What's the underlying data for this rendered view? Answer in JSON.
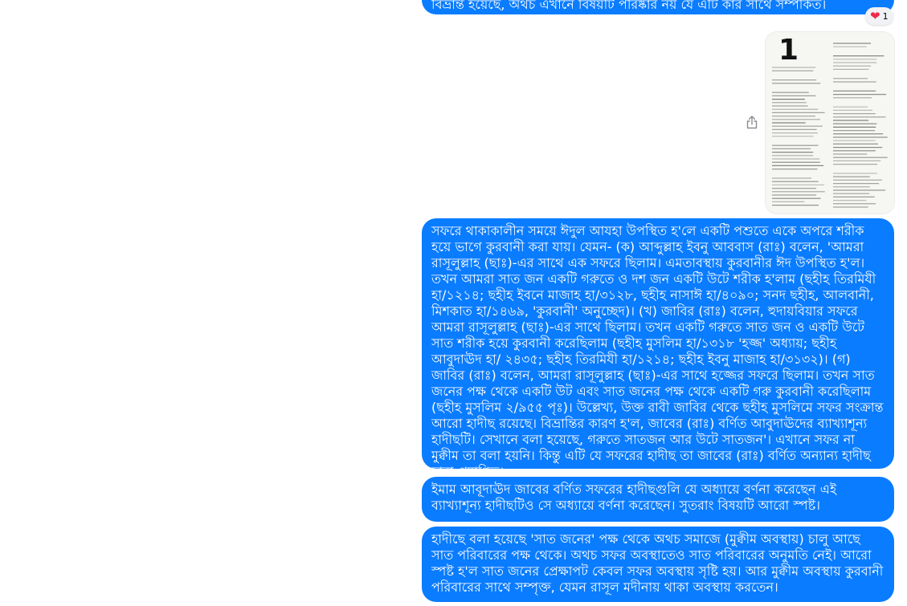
{
  "messages": {
    "top_partial": {
      "text": "বিভ্রান্ত হয়েছে, অথচ এখানে বিষয়টি পরিষ্কার নয় যে এটি কার সাথে সম্পর্কিত।",
      "reaction_emoji": "❤",
      "reaction_count": "1"
    },
    "image_message": {
      "page_number": "1"
    },
    "msg1": "সফরে থাকাকালীন সময়ে ঈদুল আযহা উপস্থিত হ'লে একটি পশুতে একে অপরে শরীক হয়ে ভাগে কুরবানী করা যায়। যেমন- (ক) আব্দুল্লাহ ইবনু আববাস (রাঃ) বলেন, 'আমরা রাসূলুল্লাহ (ছাঃ)-এর সাথে এক সফরে ছিলাম। এমতাবস্থায় কুরবানীর ঈদ উপস্থিত হ'ল। তখন আমরা সাত জন একটি গরুতে ও দশ জন একটি উটে শরীক হ'লাম (ছহীহ তিরমিযী হা/১২১৪; ছহীহ ইবনে মাজাহ হা/৩১২৮, ছহীহ নাসাঈ হা/৪০৯০; সনদ ছহীহ, আলবানী, মিশকাত হা/১৪৬৯, 'কুরবানী' অনুচ্ছেদ)। (খ) জাবির (রাঃ) বলেন, হুদায়বিয়ার সফরে আমরা রাসূলুল্লাহ (ছাঃ)-এর সাথে ছিলাম। তখন একটি গরুতে সাত জন ও একটি উটে সাত শরীক হয়ে কুরবানী করেছিলাম (ছহীহ মুসলিম হা/১৩১৮ 'হজ্জ' অধ্যায়; ছহীহ আবুদাঊদ হা/ ২৪৩৫; ছহীহ তিরমিযী হা/১২১৪; ছহীহ ইবনু মাজাহ হা/৩১৩২)। (গ) জাবির (রাঃ) বলেন, আমরা রাসূলুল্লাহ (ছাঃ)-এর সাথে হজ্জের সফরে ছিলাম। তখন সাত জনের পক্ষ থেকে একটি উট এবং সাত জনের পক্ষ থেকে একটি গরু কুরবানী করেছিলাম (ছহীহ মুসলিম ২/৯৫৫ পৃঃ)। উল্লেখ্য, উক্ত রাবী জাবির থেকে ছহীহ মুসলিমে সফর সংক্রান্ত আরো হাদীছ রয়েছে। বিভ্রান্তির কারণ হ'ল, জাবের (রাঃ) বর্ণিত আবুদাঊদের ব্যাখ্যাশূন্য হাদীছটি। সেখানে বলা হয়েছে, গরুতে সাতজন আর উটে সাতজন'। এখানে সফর না মুক্বীম তা বলা হয়নি। কিন্তু এটি যে সফরের হাদীছ তা জাবের (রাঃ) বর্ণিত অন্যান্য হাদীছ দ্বারা প্রমাণিত।",
    "msg2": "ইমাম আবূদাঊদ জাবের বর্ণিত সফরের হাদীছগুলি যে অধ্যায়ে  বর্ণনা করেছেন এই ব্যাখ্যাশূন্য হাদীছটিও সে অধ্যায়ে বর্ণনা করেছেন। সুতরাং বিষয়টি আরো স্পষ্ট।",
    "msg3": "হাদীছে বলা হয়েছে 'সাত জনের' পক্ষ থেকে অথচ সমাজে (মুক্বীম অবস্থায়) চালু আছে সাত পরিবারের পক্ষ থেকে। অথচ সফর অবস্থাতেও সাত পরিবারের অনুমতি নেই। আরো স্পষ্ট হ'ল সাত জনের প্রেক্ষাপট কেবল সফর অবস্থায় সৃষ্টি হয়। আর মুক্বীম অবস্থায় কুরবানী পরিবারের সাথে সম্পৃক্ত, যেমন রাসূল মদীনায় থাকা অবস্থায় করতেন।"
  },
  "icons": {
    "share": "share-icon",
    "heart": "heart-icon"
  },
  "colors": {
    "bubble": "#0a7cff",
    "bubble_text": "#ffffff",
    "background": "#ffffff"
  }
}
